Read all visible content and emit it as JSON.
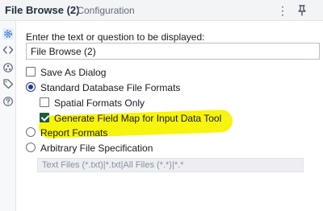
{
  "header": {
    "title": "File Browse (2)",
    "subtitle": "- Configuration",
    "menu_icon": "more-vertical-icon",
    "pin_icon": "pin-icon"
  },
  "rail": {
    "icons": [
      "gear-icon",
      "code-icon",
      "network-icon",
      "tag-icon",
      "help-icon"
    ]
  },
  "form": {
    "prompt_label": "Enter the text or question to be displayed:",
    "prompt_value": "File Browse (2)",
    "save_as_dialog": {
      "label": "Save As Dialog",
      "checked": false
    },
    "standard_db_formats": {
      "label": "Standard Database File Formats",
      "selected": true
    },
    "spatial_formats_only": {
      "label": "Spatial Formats Only",
      "checked": false
    },
    "generate_field_map": {
      "label": "Generate Field Map for Input Data Tool",
      "checked": true
    },
    "report_formats": {
      "label": "Report Formats",
      "selected": false
    },
    "arbitrary_file_spec": {
      "label": "Arbitrary File Specification",
      "selected": false
    },
    "file_spec_value": "Text Files (*.txt)|*.txt|All Files (*.*)|*.*"
  },
  "colors": {
    "highlight": "#f7f300",
    "checkbox_checked": "#1e5a3a",
    "radio_selected": "#1f3a8a"
  }
}
